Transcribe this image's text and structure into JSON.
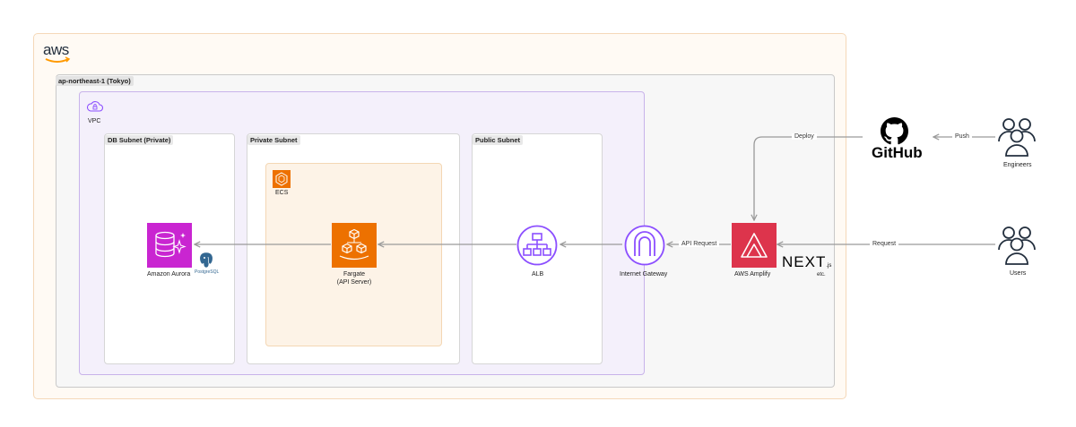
{
  "aws_logo": "aws",
  "region": {
    "label": "ap-northeast-1 (Tokyo)"
  },
  "vpc": {
    "label": "VPC"
  },
  "subnets": {
    "db": "DB Subnet (Private)",
    "private": "Private Subnet",
    "public": "Public Subnet"
  },
  "ecs": {
    "label": "ECS"
  },
  "nodes": {
    "aurora": "Amazon Aurora",
    "postgresql": "PostgreSQL",
    "fargate_line1": "Fargate",
    "fargate_line2": "(API Server)",
    "alb": "ALB",
    "igw": "Internet Gateway",
    "amplify": "AWS Amplify",
    "nextjs": "NEXT",
    "nextjs_suffix": ".js",
    "etc": "etc.",
    "github": "GitHub",
    "engineers": "Engineers",
    "users": "Users"
  },
  "edges": {
    "deploy": "Deploy",
    "push": "Push",
    "api_request": "API Request",
    "request": "Request"
  },
  "colors": {
    "aws_cloud_border": "#f5d8b8",
    "aws_cloud_fill": "#fffaf4",
    "region_border": "#c9c9c9",
    "region_fill": "#f7f7f7",
    "vpc_border": "#c8b3ea",
    "vpc_fill": "#f4f0fb",
    "subnet_border": "#d6d6d6",
    "ecs_border": "#f4d7b4",
    "ecs_fill": "#fdf3e7",
    "aurora": "#c925d1",
    "compute": "#ed7100",
    "network": "#8c4fff",
    "amplify": "#dd344c",
    "arrow": "#9a9a9a"
  }
}
